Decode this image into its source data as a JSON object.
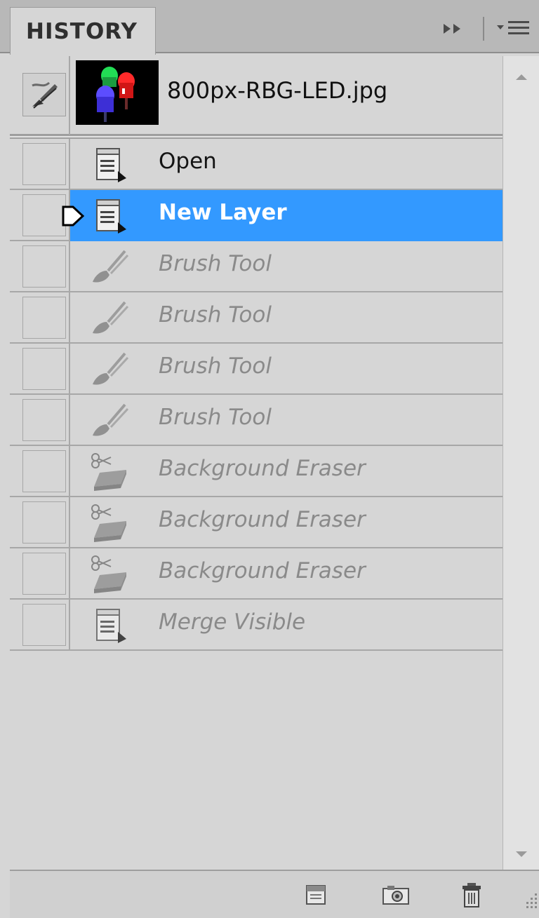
{
  "panel": {
    "tab_label": "HISTORY"
  },
  "snapshot": {
    "name": "800px-RBG-LED.jpg",
    "thumbnail_icon": "rgb-led-thumbnail"
  },
  "history": {
    "items": [
      {
        "label": "Open",
        "icon": "document-icon",
        "state": "done"
      },
      {
        "label": "New Layer",
        "icon": "document-icon",
        "state": "selected"
      },
      {
        "label": "Brush Tool",
        "icon": "brush-icon",
        "state": "future"
      },
      {
        "label": "Brush Tool",
        "icon": "brush-icon",
        "state": "future"
      },
      {
        "label": "Brush Tool",
        "icon": "brush-icon",
        "state": "future"
      },
      {
        "label": "Brush Tool",
        "icon": "brush-icon",
        "state": "future"
      },
      {
        "label": "Background Eraser",
        "icon": "background-eraser-icon",
        "state": "future"
      },
      {
        "label": "Background Eraser",
        "icon": "background-eraser-icon",
        "state": "future"
      },
      {
        "label": "Background Eraser",
        "icon": "background-eraser-icon",
        "state": "future"
      },
      {
        "label": "Merge Visible",
        "icon": "document-icon",
        "state": "future"
      }
    ]
  },
  "footer": {
    "buttons": [
      "new-document-from-state-icon",
      "new-snapshot-icon",
      "delete-state-icon"
    ]
  },
  "colors": {
    "selection": "#3399ff",
    "panel_bg": "#d6d6d6",
    "future_text": "#8a8a8a"
  }
}
